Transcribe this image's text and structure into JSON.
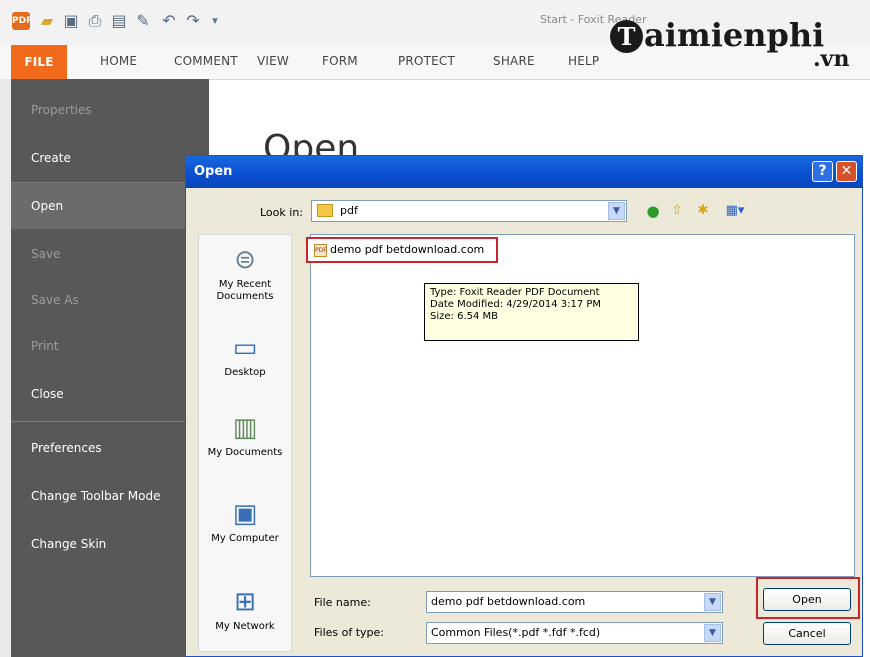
{
  "app": {
    "window_title": "Start - Foxit Reader",
    "logo_icon": "foxit-logo-icon"
  },
  "quick_access": {
    "icons": [
      "open-folder-icon",
      "save-icon",
      "print-icon",
      "screenshot-icon",
      "new-icon",
      "undo-icon",
      "redo-icon",
      "customize-icon"
    ]
  },
  "ribbon": {
    "tabs": [
      "FILE",
      "HOME",
      "COMMENT",
      "VIEW",
      "FORM",
      "PROTECT",
      "SHARE",
      "HELP"
    ]
  },
  "watermark": {
    "letter": "T",
    "text": "aimienphi",
    "suffix": ".vn"
  },
  "left_nav": {
    "items": [
      {
        "label": "Properties"
      },
      {
        "label": "Create"
      },
      {
        "label": "Open"
      },
      {
        "label": "Save"
      },
      {
        "label": "Save As"
      },
      {
        "label": "Print"
      },
      {
        "label": "Close"
      },
      {
        "label": "Preferences"
      },
      {
        "label": "Change Toolbar Mode"
      },
      {
        "label": "Change Skin"
      }
    ]
  },
  "main": {
    "heading": "Open"
  },
  "dialog": {
    "title": "Open",
    "help_symbol": "?",
    "close_symbol": "✕",
    "look_in_label": "Look in:",
    "look_in_value": "pdf",
    "places": [
      {
        "label": "My Recent Documents",
        "icon": "recent-documents-icon"
      },
      {
        "label": "Desktop",
        "icon": "desktop-icon"
      },
      {
        "label": "My Documents",
        "icon": "my-documents-icon"
      },
      {
        "label": "My Computer",
        "icon": "my-computer-icon"
      },
      {
        "label": "My Network",
        "icon": "my-network-icon"
      }
    ],
    "files": [
      {
        "name": "demo pdf betdownload.com"
      }
    ],
    "tooltip": {
      "type": "Type: Foxit Reader PDF Document",
      "modified": "Date Modified: 4/29/2014 3:17 PM",
      "size": "Size: 6.54 MB"
    },
    "file_name_label": "File name:",
    "file_name_value": "demo pdf betdownload.com",
    "file_type_label": "Files of type:",
    "file_type_value": "Common Files(*.pdf *.fdf *.fcd)",
    "open_button": "Open",
    "cancel_button": "Cancel"
  },
  "colors": {
    "file_tab": "#f16a1c",
    "left_nav": "#585858",
    "dialog_title": "#0a4fd0",
    "highlight": "#c8262c"
  }
}
